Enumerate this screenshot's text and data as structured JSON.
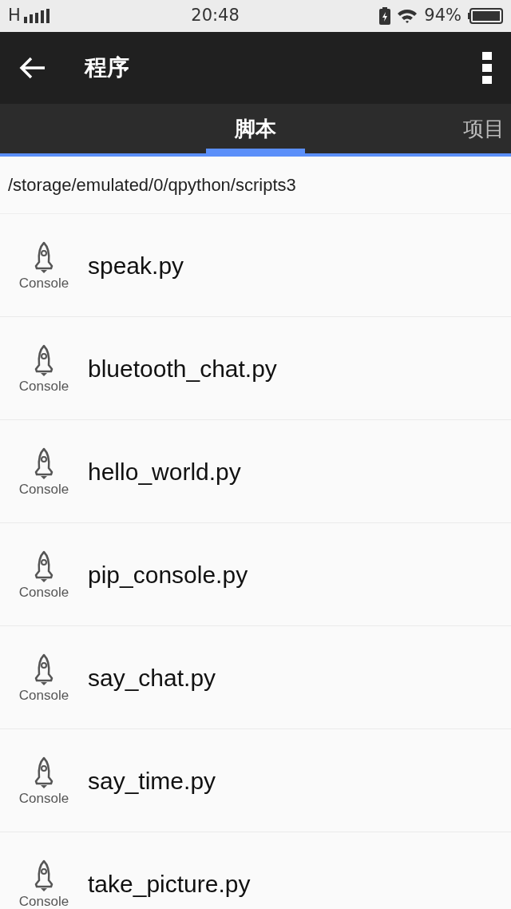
{
  "status_bar": {
    "network": "H",
    "time": "20:48",
    "battery": "94%"
  },
  "app_bar": {
    "title": "程序"
  },
  "tabs": [
    {
      "label": "脚本",
      "selected": true
    },
    {
      "label": "项目",
      "selected": false
    }
  ],
  "path": "/storage/emulated/0/qpython/scripts3",
  "scripts": [
    {
      "icon_label": "Console",
      "name": "speak.py"
    },
    {
      "icon_label": "Console",
      "name": "bluetooth_chat.py"
    },
    {
      "icon_label": "Console",
      "name": "hello_world.py"
    },
    {
      "icon_label": "Console",
      "name": "pip_console.py"
    },
    {
      "icon_label": "Console",
      "name": "say_chat.py"
    },
    {
      "icon_label": "Console",
      "name": "say_time.py"
    },
    {
      "icon_label": "Console",
      "name": "take_picture.py"
    }
  ]
}
